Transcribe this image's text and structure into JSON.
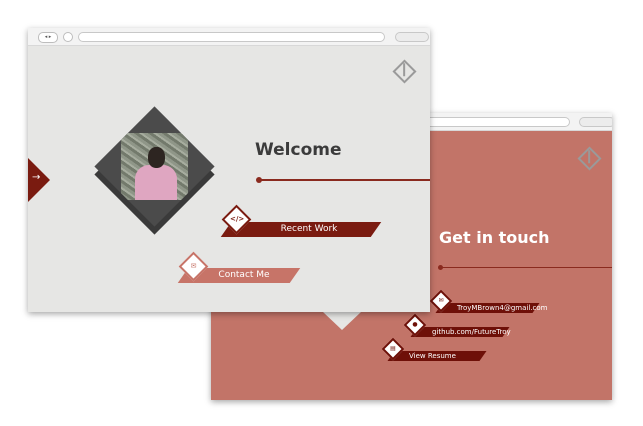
{
  "front": {
    "title": "Welcome",
    "recent_work_label": "Recent Work",
    "recent_work_icon": "</>",
    "contact_label": "Contact Me",
    "contact_icon": "✉",
    "nav_glyph": "◂ ▸",
    "arrow_glyph": "→"
  },
  "back": {
    "title": "Get in touch",
    "links": [
      {
        "label": "TroyMBrown4@gmail.com",
        "icon": "✉"
      },
      {
        "label": "github.com/FutureTroy",
        "icon": "●"
      },
      {
        "label": "View Resume",
        "icon": "▤"
      }
    ]
  },
  "colors": {
    "accent_dark": "#7a1b10",
    "accent_light": "#c77468",
    "back_bg": "#c27468",
    "front_bg": "#e6e6e4"
  },
  "icons": [
    "logo-icon",
    "arrow-right-icon",
    "code-icon",
    "mail-icon",
    "github-icon",
    "document-icon"
  ]
}
